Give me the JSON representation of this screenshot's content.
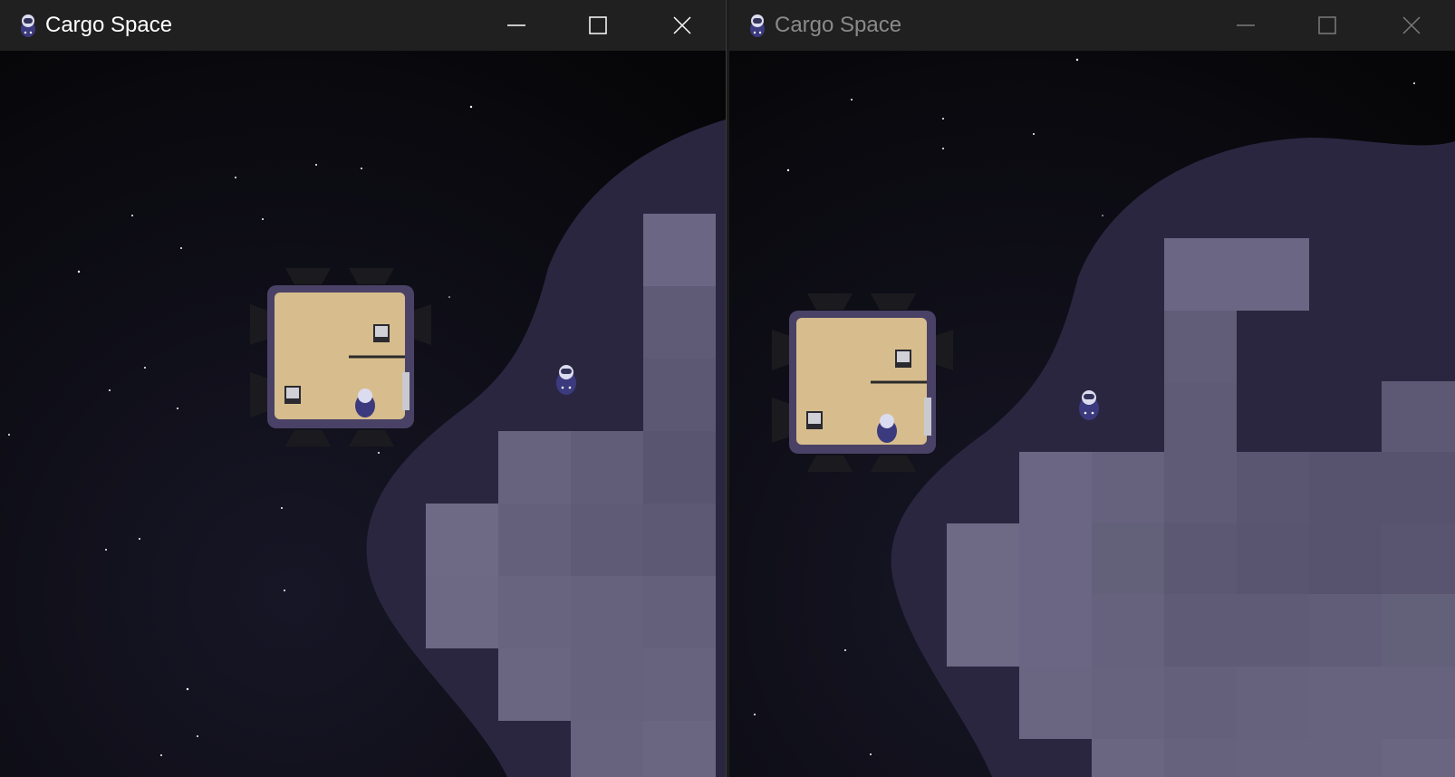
{
  "windows": [
    {
      "title": "Cargo Space",
      "active": true,
      "icons": {
        "app": "astronaut-app-icon",
        "minimize": "minimize-icon",
        "maximize": "maximize-icon",
        "close": "close-icon"
      }
    },
    {
      "title": "Cargo Space",
      "active": false,
      "icons": {
        "app": "astronaut-app-icon",
        "minimize": "minimize-icon",
        "maximize": "maximize-icon",
        "close": "close-icon"
      }
    }
  ],
  "colors": {
    "titlebar": "#202020",
    "space": "#0b0a12",
    "nebula": "#2a2640",
    "tile": "#6a6580",
    "ship_floor": "#d9bf8f",
    "ship_frame": "#4a4266",
    "astronaut": "#3c3a7e"
  }
}
